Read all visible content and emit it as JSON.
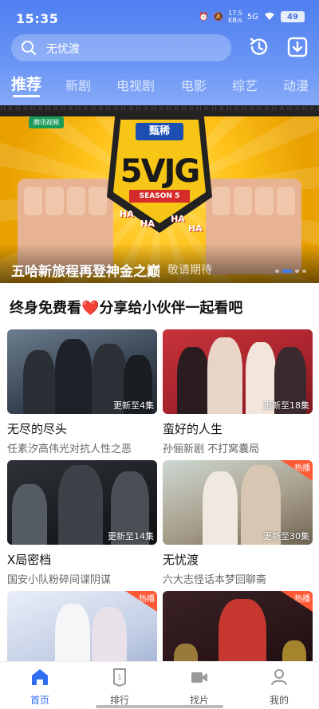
{
  "status": {
    "time": "15:35",
    "speed_value": "17.5",
    "speed_unit": "KB/s",
    "network": "5G",
    "battery": "49"
  },
  "search": {
    "placeholder": "无忧渡"
  },
  "tabs": [
    {
      "label": "推荐",
      "active": true
    },
    {
      "label": "新剧"
    },
    {
      "label": "电视剧"
    },
    {
      "label": "电影"
    },
    {
      "label": "综艺"
    },
    {
      "label": "动漫"
    }
  ],
  "banner": {
    "strip": "HAHAHAHAHAHAHAHAHAHAHAHAHAHAHAHAHAHAHAHAHAHAHAHAHAHAHA",
    "channel": "腾讯视频",
    "brand": "甄稀",
    "big": "5VJG",
    "season": "SEASON 5",
    "title": "五哈新旅程再登神金之巅",
    "subtitle": "敬请期待",
    "dots": 4,
    "active_dot": 1
  },
  "section": {
    "title": "终身免费看❤️分享给小伙伴一起看吧"
  },
  "cards": [
    {
      "title": "无尽的尽头",
      "subtitle": "任素汐高伟光对抗人性之恶",
      "update": "更新至4集",
      "hot": false
    },
    {
      "title": "蛮好的人生",
      "subtitle": "孙俪新剧 不打窝囊局",
      "update": "更新至18集",
      "hot": false
    },
    {
      "title": "X局密档",
      "subtitle": "国安小队粉碎间谍阴谋",
      "update": "更新至14集",
      "hot": false
    },
    {
      "title": "无忧渡",
      "subtitle": "六大志怪话本梦回聊斋",
      "update": "更新至30集",
      "hot": true
    },
    {
      "title": "",
      "subtitle": "",
      "update": "",
      "hot": true
    },
    {
      "title": "",
      "subtitle": "",
      "update": "",
      "hot": true
    }
  ],
  "hot_label": "热播",
  "bottom_nav": [
    {
      "label": "首页",
      "active": true
    },
    {
      "label": "排行"
    },
    {
      "label": "找片"
    },
    {
      "label": "我的"
    }
  ],
  "colors": {
    "accent": "#2f6ef2",
    "header": "#5a88f2",
    "hot": "#ff5a36"
  }
}
